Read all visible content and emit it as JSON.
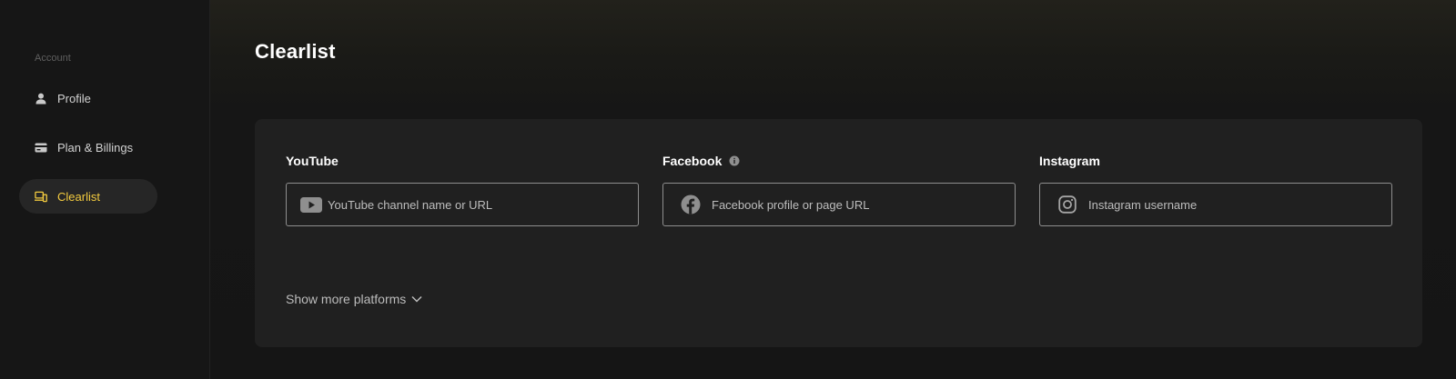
{
  "sidebar": {
    "section_label": "Account",
    "items": [
      {
        "label": "Profile",
        "icon": "user-icon",
        "active": false
      },
      {
        "label": "Plan & Billings",
        "icon": "credit-card-icon",
        "active": false
      },
      {
        "label": "Clearlist",
        "icon": "devices-icon",
        "active": true
      }
    ]
  },
  "main": {
    "title": "Clearlist",
    "platforms": [
      {
        "label": "YouTube",
        "icon": "youtube-icon",
        "placeholder": "YouTube channel name or URL",
        "value": ""
      },
      {
        "label": "Facebook",
        "icon": "facebook-icon",
        "has_info": true,
        "placeholder": "Facebook profile or page URL",
        "value": ""
      },
      {
        "label": "Instagram",
        "icon": "instagram-icon",
        "placeholder": "Instagram username",
        "value": ""
      }
    ],
    "show_more_label": "Show more platforms"
  },
  "colors": {
    "accent": "#f3cb3f",
    "background": "#151515",
    "card": "#202020",
    "sidebar": "#161616"
  }
}
